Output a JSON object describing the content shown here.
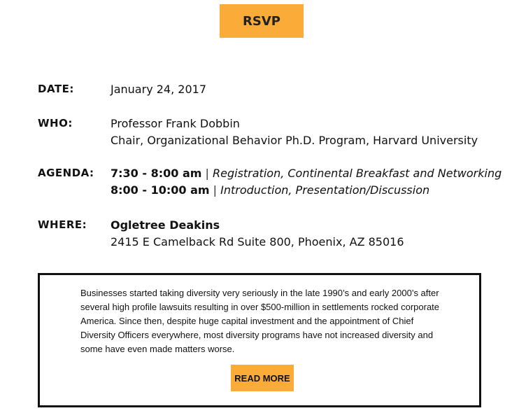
{
  "rsvp_label": "RSVP",
  "date": {
    "label": "DATE:",
    "value": "January 24, 2017"
  },
  "who": {
    "label": "WHO:",
    "name": "Professor Frank Dobbin",
    "title": "Chair, Organizational Behavior Ph.D. Program, Harvard University"
  },
  "agenda": {
    "label": "AGENDA:",
    "items": [
      {
        "time": "7:30 - 8:00 am",
        "separator": "|",
        "desc": "Registration, Continental Breakfast and Networking"
      },
      {
        "time": "8:00 - 10:00 am",
        "separator": "|",
        "desc": "Introduction, Presentation/Discussion"
      }
    ]
  },
  "where": {
    "label": "WHERE:",
    "venue": "Ogletree Deakins",
    "address": "2415 E Camelback Rd Suite 800, Phoenix, AZ 85016"
  },
  "summary": {
    "text": "Businesses started taking diversity very seriously in the late 1990’s and early 2000’s after several high profile lawsuits resulting in over $500-million in settlements rocked corporate America. Since then, despite huge capital investment and the appointment of Chief Diversity Officers everywhere, most diversity programs have not increased diversity and some have even made matters worse.",
    "read_more_label": "READ MORE"
  },
  "colors": {
    "accent": "#fbac38",
    "text": "#111111",
    "border": "#111111"
  }
}
